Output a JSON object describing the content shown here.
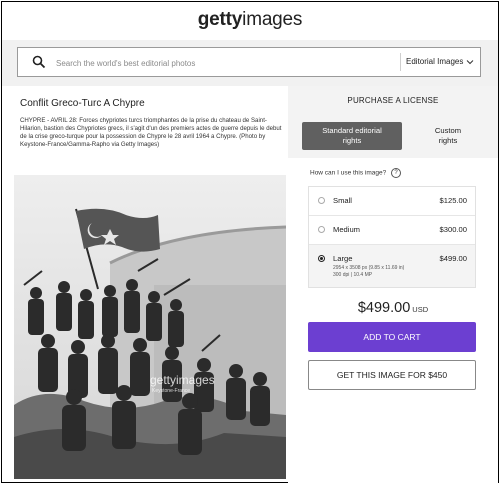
{
  "brand": {
    "logo_bold": "getty",
    "logo_light": "images"
  },
  "search": {
    "placeholder": "Search the world's best editorial photos",
    "filter_label": "Editorial Images"
  },
  "image": {
    "title": "Conflit Greco-Turc A Chypre",
    "caption": "CHYPRE - AVRIL 28: Forces chypriotes turcs triomphantes de la prise du chateau de Saint-Hilarion, bastion des Chypriotes grecs, il s'agit d'un des premiers actes de guerre depuis le debut de la crise greco-turque pour la possession de Chypre le 28 avril 1964 a Chypre. (Photo by Keystone-France/Gamma-Rapho via Getty Images)",
    "watermark": "gettyimages",
    "watermark_credit": "Keystone-France"
  },
  "purchase": {
    "title": "PURCHASE A LICENSE",
    "tabs": [
      {
        "line1": "Standard editorial",
        "line2": "rights"
      },
      {
        "line1": "Custom",
        "line2": "rights"
      }
    ],
    "question": "How can I use this image?",
    "help_glyph": "?",
    "options": [
      {
        "label": "Small",
        "price": "$125.00"
      },
      {
        "label": "Medium",
        "price": "$300.00"
      },
      {
        "label": "Large",
        "price": "$499.00",
        "detail1": "2954 x 3508 px (9.85 x 11.69 in)",
        "detail2": "300 dpi | 10.4 MP"
      }
    ],
    "total_amount": "$499.00",
    "total_currency": "USD",
    "add_to_cart": "ADD TO CART",
    "get_image": "GET THIS IMAGE FOR $450"
  }
}
